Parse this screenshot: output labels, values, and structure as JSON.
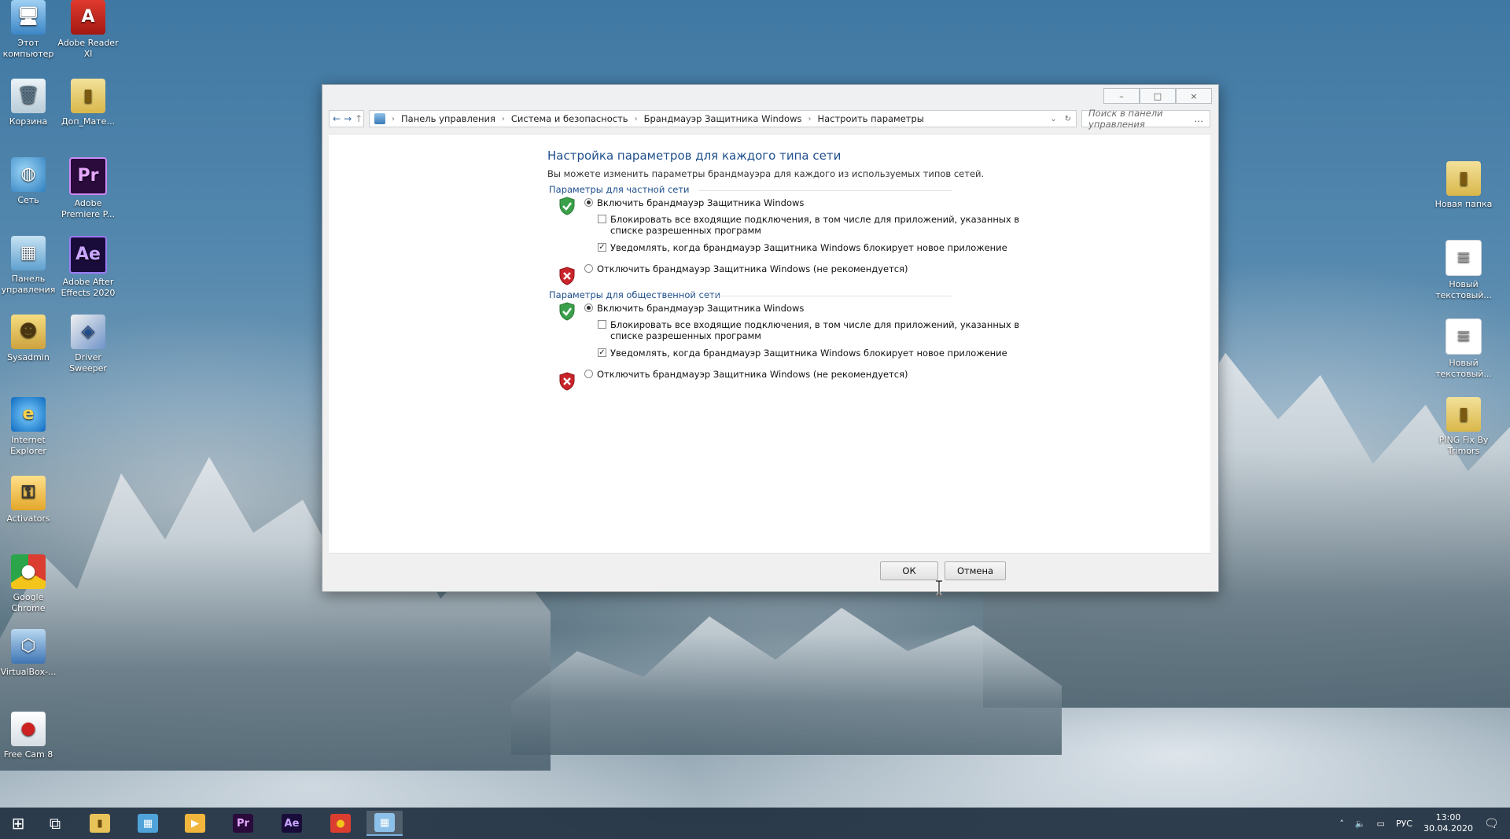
{
  "desktop": {
    "left_icons": [
      {
        "label": "Этот компьютер",
        "glyph": "🖥",
        "cls": "g-comp"
      },
      {
        "label": "Adobe Reader XI",
        "glyph": "A",
        "cls": "g-pdf"
      },
      {
        "label": "Корзина",
        "glyph": "🗑",
        "cls": "g-bin"
      },
      {
        "label": "Доп_Мате...",
        "glyph": "▮",
        "cls": "g-fold"
      },
      {
        "label": "Сеть",
        "glyph": "◍",
        "cls": "g-net"
      },
      {
        "label": "Adobe Premiere P...",
        "glyph": "Pr",
        "cls": "g-pr"
      },
      {
        "label": "Панель управления",
        "glyph": "▦",
        "cls": "g-cp"
      },
      {
        "label": "Adobe After Effects 2020",
        "glyph": "Ae",
        "cls": "g-ae"
      },
      {
        "label": "Sysadmin",
        "glyph": "☻",
        "cls": "g-user"
      },
      {
        "label": "Driver Sweeper",
        "glyph": "◈",
        "cls": "g-drv"
      },
      {
        "label": "Internet Explorer",
        "glyph": "e",
        "cls": "g-ie"
      },
      {
        "label": "Activators",
        "glyph": "⚿",
        "cls": "g-act"
      },
      {
        "label": "Google Chrome",
        "glyph": "●",
        "cls": "g-chrome"
      },
      {
        "label": "VirtualBox-...",
        "glyph": "⬡",
        "cls": "g-vbox"
      },
      {
        "label": "Free Cam 8",
        "glyph": "●",
        "cls": "g-cam"
      }
    ],
    "right_icons": [
      {
        "label": "Новая папка",
        "glyph": "▮",
        "cls": "g-fold"
      },
      {
        "label": "Новый текстовый...",
        "glyph": "≡",
        "cls": "g-doc"
      },
      {
        "label": "Новый текстовый...",
        "glyph": "≡",
        "cls": "g-doc"
      },
      {
        "label": "PING Fix By Trimors",
        "glyph": "▮",
        "cls": "g-fold"
      }
    ]
  },
  "window": {
    "controls": {
      "minimize": "–",
      "maximize": "□",
      "close": "×"
    },
    "nav": {
      "back": "←",
      "forward": "→",
      "up": "↑"
    },
    "breadcrumb": [
      "Панель управления",
      "Система и безопасность",
      "Брандмауэр Защитника Windows",
      "Настроить параметры"
    ],
    "search_placeholder": "Поиск в панели управления",
    "title": "Настройка параметров для каждого типа сети",
    "description": "Вы можете изменить параметры брандмауэра для каждого из используемых типов сетей.",
    "private": {
      "heading": "Параметры для частной сети",
      "enable": "Включить брандмауэр Защитника Windows",
      "block_line1": "Блокировать все входящие подключения, в том числе для приложений, указанных в",
      "block_line2": "списке разрешенных программ",
      "notify": "Уведомлять, когда брандмауэр Защитника Windows блокирует новое приложение",
      "disable": "Отключить брандмауэр Защитника Windows (не рекомендуется)"
    },
    "public": {
      "heading": "Параметры для общественной сети",
      "enable": "Включить брандмауэр Защитника Windows",
      "block_line1": "Блокировать все входящие подключения, в том числе для приложений, указанных в",
      "block_line2": "списке разрешенных программ",
      "notify": "Уведомлять, когда брандмауэр Защитника Windows блокирует новое приложение",
      "disable": "Отключить брандмауэр Защитника Windows (не рекомендуется)"
    },
    "ok_label": "ОК",
    "cancel_label": "Отмена"
  },
  "taskbar": {
    "apps": [
      {
        "name": "start-button",
        "glyph": "⊞",
        "bg": "transparent",
        "color": "#ffffff"
      },
      {
        "name": "task-view-button",
        "glyph": "⧉",
        "bg": "transparent",
        "color": "#ffffff"
      },
      {
        "name": "explorer-taskbar-button",
        "glyph": "▮",
        "bg": "#e8c35a",
        "color": "#6a4b0e"
      },
      {
        "name": "store-taskbar-button",
        "glyph": "▦",
        "bg": "#4fa3d9",
        "color": "#ffffff"
      },
      {
        "name": "media-player-taskbar-button",
        "glyph": "▶",
        "bg": "#f2b63c",
        "color": "#ffffff"
      },
      {
        "name": "premiere-taskbar-button",
        "glyph": "Pr",
        "bg": "#2a0b3c",
        "color": "#e6a8ff"
      },
      {
        "name": "after-effects-taskbar-button",
        "glyph": "Ae",
        "bg": "#1a0c3a",
        "color": "#c9a6ff"
      },
      {
        "name": "chrome-taskbar-button",
        "glyph": "●",
        "bg": "#db3e30",
        "color": "#f3c51b"
      },
      {
        "name": "control-panel-taskbar-button",
        "glyph": "▦",
        "bg": "#8cc0e8",
        "color": "#ffffff"
      }
    ],
    "lang": "РУС",
    "time": "13:00",
    "date": "30.04.2020"
  }
}
